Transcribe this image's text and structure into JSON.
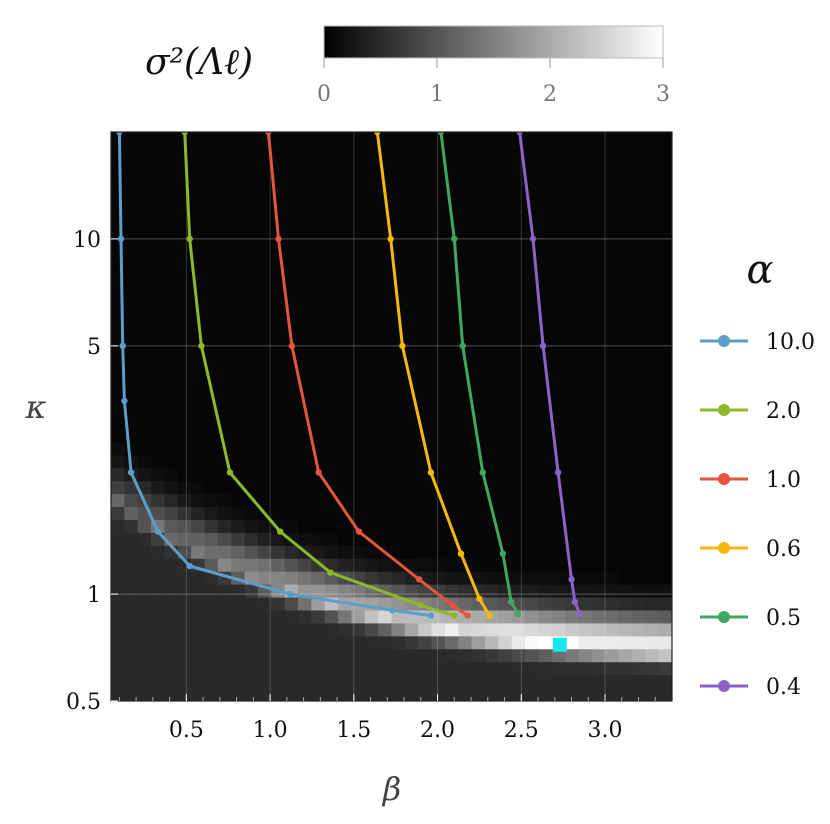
{
  "chart_data": {
    "type": "line",
    "background": "heatmap",
    "colorbar": {
      "title": "σ²(Λℓ)",
      "range": [
        0,
        3
      ],
      "ticks": [
        "0",
        "1",
        "2",
        "3"
      ],
      "colors": [
        "#000000",
        "#ffffff"
      ]
    },
    "xlabel": "β",
    "ylabel": "κ",
    "xlim": [
      0.05,
      3.4
    ],
    "ylim": [
      0.5,
      20
    ],
    "yscale": "log",
    "xticks": [
      "0.5",
      "1.0",
      "1.5",
      "2.0",
      "2.5",
      "3.0"
    ],
    "yticks": [
      "0.5",
      "1",
      "5",
      "10"
    ],
    "legend_title": "α",
    "legend_position": "right",
    "series": [
      {
        "name": "10.0",
        "color": "#5b9ec9",
        "x": [
          0.1,
          0.11,
          0.12,
          0.13,
          0.17,
          0.33,
          0.52,
          1.12,
          1.73,
          1.96
        ],
        "y": [
          20,
          10,
          5,
          3.5,
          2.2,
          1.5,
          1.2,
          1.0,
          0.9,
          0.87
        ]
      },
      {
        "name": "2.0",
        "color": "#8db829",
        "x": [
          0.49,
          0.52,
          0.59,
          0.76,
          1.06,
          1.36,
          1.9,
          2.1
        ],
        "y": [
          20,
          10,
          5,
          2.2,
          1.5,
          1.15,
          0.93,
          0.87
        ]
      },
      {
        "name": "1.0",
        "color": "#e4553b",
        "x": [
          0.99,
          1.05,
          1.13,
          1.29,
          1.53,
          1.89,
          2.09,
          2.18
        ],
        "y": [
          20,
          10,
          5,
          2.2,
          1.5,
          1.1,
          0.93,
          0.87
        ]
      },
      {
        "name": "0.6",
        "color": "#f5b80f",
        "x": [
          1.64,
          1.72,
          1.79,
          1.96,
          2.14,
          2.25,
          2.31
        ],
        "y": [
          20,
          10,
          5,
          2.2,
          1.3,
          0.97,
          0.87
        ]
      },
      {
        "name": "0.5",
        "color": "#40a85e",
        "x": [
          2.02,
          2.1,
          2.15,
          2.27,
          2.39,
          2.44,
          2.48
        ],
        "y": [
          20,
          10,
          5,
          2.2,
          1.3,
          0.95,
          0.88
        ]
      },
      {
        "name": "0.4",
        "color": "#8c62c7",
        "x": [
          2.49,
          2.57,
          2.63,
          2.72,
          2.8,
          2.82,
          2.85
        ],
        "y": [
          20,
          10,
          5,
          2.2,
          1.1,
          0.95,
          0.88
        ]
      }
    ],
    "marker": {
      "x": 2.73,
      "y": 0.72,
      "color": "#15e8ee",
      "shape": "square"
    }
  }
}
